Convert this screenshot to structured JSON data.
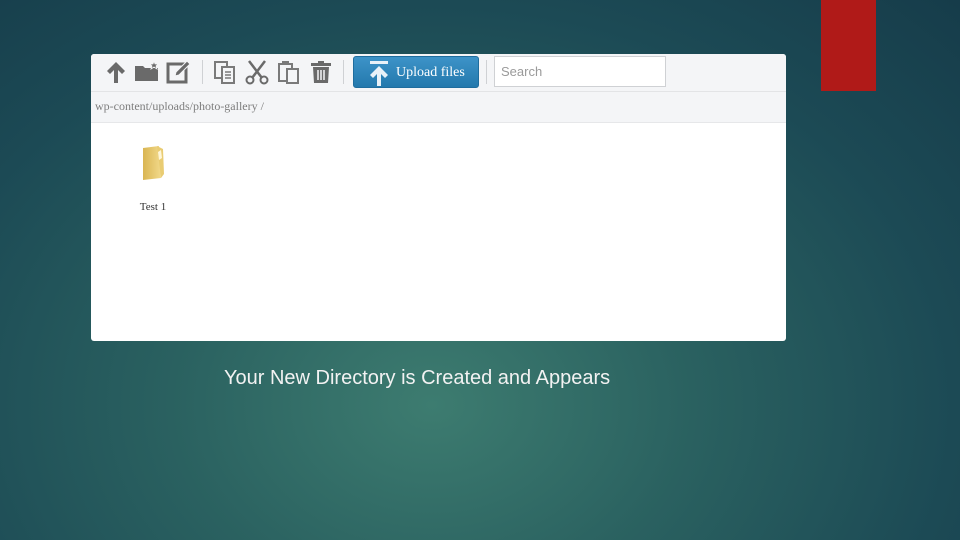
{
  "slide": {
    "caption": "Your New Directory is Created and Appears",
    "accent_color": "#b01a18"
  },
  "file_manager": {
    "toolbar": {
      "icons": [
        {
          "name": "go-up-icon"
        },
        {
          "name": "new-folder-icon"
        },
        {
          "name": "rename-icon"
        },
        {
          "name": "copy-icon"
        },
        {
          "name": "cut-icon"
        },
        {
          "name": "paste-icon"
        },
        {
          "name": "delete-icon"
        }
      ],
      "upload_label": "Upload files",
      "upload_color": "#2f86bd",
      "search_placeholder": "Search",
      "search_value": ""
    },
    "breadcrumb": "wp-content/uploads/photo-gallery  /",
    "items": [
      {
        "type": "folder",
        "name": "Test 1"
      }
    ]
  }
}
